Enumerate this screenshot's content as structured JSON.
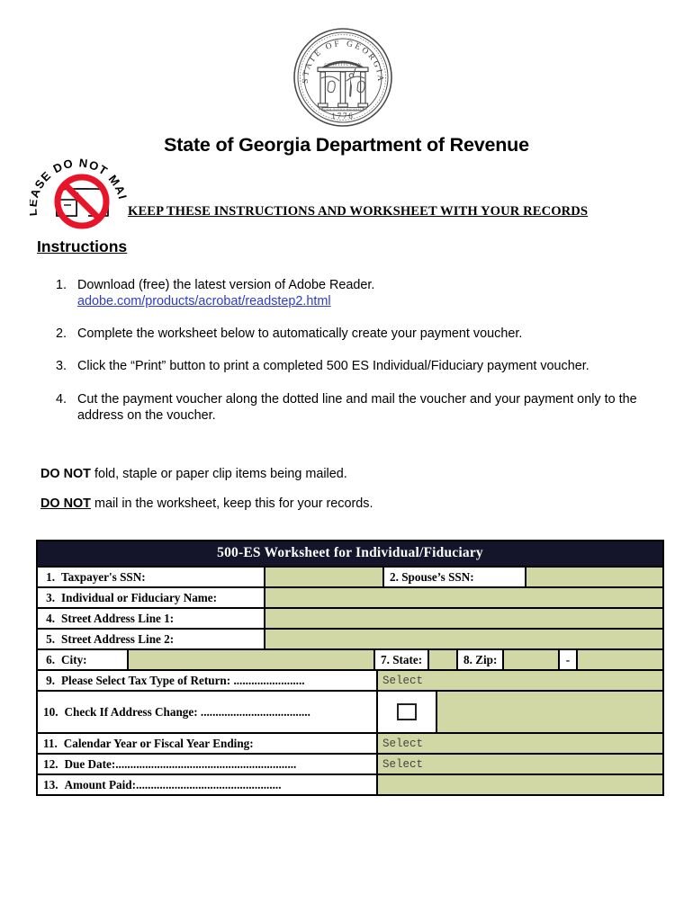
{
  "seal": {
    "outer_text": "STATE OF GEORGIA",
    "motto": "CONSTITUTION",
    "pillar_labels": [
      "WISDOM",
      "JUSTICE",
      "MODERATION"
    ],
    "year": "1776"
  },
  "header": {
    "title": "State of Georgia Department of Revenue",
    "keep_notice": "KEEP THESE INSTRUCTIONS AND WORKSHEET WITH YOUR RECORDS"
  },
  "stamp": {
    "text": "PLEASE DO NOT MAIL!",
    "icon": "no-mail-icon",
    "color": "#e8152a"
  },
  "instructions": {
    "heading": "Instructions",
    "steps": [
      {
        "num": "1.",
        "text": "Download (free) the latest version of Adobe Reader.",
        "link": "adobe.com/products/acrobat/readstep2.html"
      },
      {
        "num": "2.",
        "text": "Complete the worksheet below to automatically create your payment voucher.",
        "link": ""
      },
      {
        "num": "3.",
        "text": "Click the “Print” button to print a completed 500 ES Individual/Fiduciary payment voucher.",
        "link": ""
      },
      {
        "num": "4.",
        "text": "Cut the payment voucher along the dotted line and mail the voucher and your payment only to the address on the voucher.",
        "link": ""
      }
    ]
  },
  "notes": {
    "note1_bold": "DO NOT",
    "note1_rest": " fold, staple or paper clip items being mailed.",
    "note2_bold": "DO NOT",
    "note2_rest": " mail in the worksheet, keep this for your records."
  },
  "worksheet": {
    "title": "500-ES Worksheet for Individual/Fiduciary",
    "header_bg": "#14142b",
    "field_bg": "#d2d7a6",
    "rows": {
      "r1_num": "1.",
      "r1_label": "Taxpayer's SSN:",
      "r1_value": "",
      "r2_label": "2. Spouse’s SSN:",
      "r2_value": "",
      "r3_num": "3.",
      "r3_label": "Individual or Fiduciary Name:",
      "r3_value": "",
      "r4_num": "4.",
      "r4_label": "Street Address Line 1:",
      "r4_value": "",
      "r5_num": "5.",
      "r5_label": "Street Address Line 2:",
      "r5_value": "",
      "r6_num": "6.",
      "r6_label": "City:",
      "r6_value": "",
      "r7_label": "7. State:",
      "r7_value": "",
      "r8_label": "8. Zip:",
      "r8_value": "",
      "r8_dash": "-",
      "r8_value2": "",
      "r9_num": "9.",
      "r9_label": "Please Select Tax Type of Return: ........................",
      "r9_value": "Select",
      "r10_num": "10.",
      "r10_label": "Check If Address Change: .....................................",
      "r10_checked": false,
      "r11_num": "11.",
      "r11_label": "Calendar Year or Fiscal Year Ending:",
      "r11_value": "Select",
      "r12_num": "12.",
      "r12_label": "Due Date:.............................................................",
      "r12_value": "Select",
      "r13_num": "13.",
      "r13_label": "Amount Paid:.................................................",
      "r13_value": ""
    }
  }
}
